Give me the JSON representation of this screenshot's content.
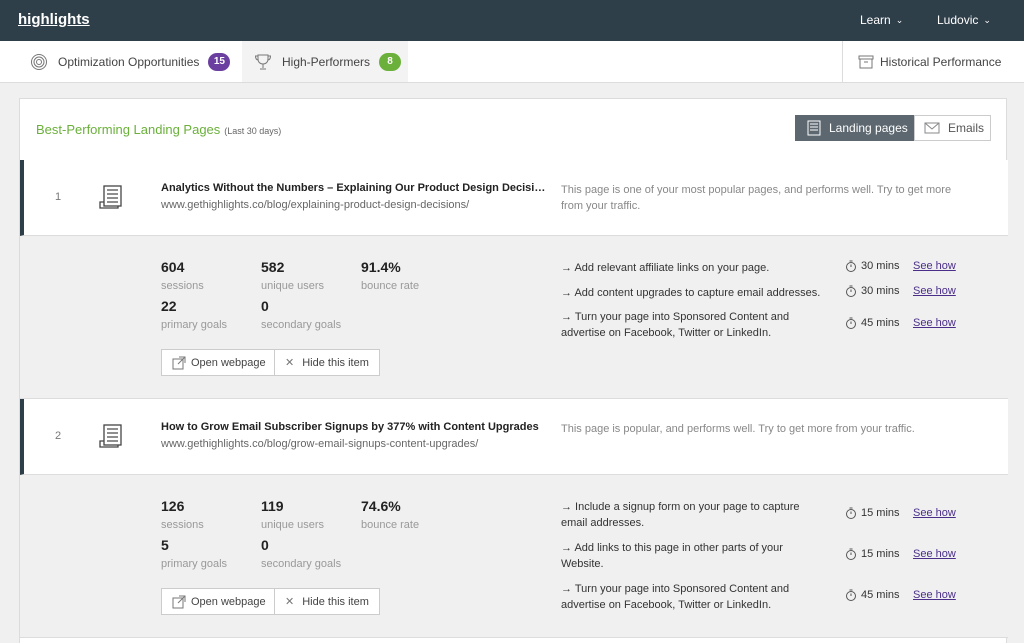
{
  "app": {
    "logo": "highlights"
  },
  "top_menu": {
    "learn": "Learn",
    "user": "Ludovic"
  },
  "tabs": [
    {
      "label": "Optimization Opportunities",
      "badge": "15",
      "badge_color": "#6b3fa0"
    },
    {
      "label": "High-Performers",
      "badge": "8",
      "badge_color": "#6ab03a"
    },
    {
      "label": "Historical Performance"
    }
  ],
  "panel": {
    "title": "Best-Performing Landing Pages",
    "subtitle": "(Last 30 days)",
    "toggle_landing": "Landing pages",
    "toggle_emails": "Emails"
  },
  "labels": {
    "sessions": "sessions",
    "unique_users": "unique users",
    "bounce_rate": "bounce rate",
    "primary_goals": "primary goals",
    "secondary_goals": "secondary goals",
    "open_webpage": "Open webpage",
    "hide_item": "Hide this item",
    "see_how": "See how"
  },
  "items": [
    {
      "num": "1",
      "title": "Analytics Without the Numbers – Explaining Our Product Design Decisions",
      "url": "www.gethighlights.co/blog/explaining-product-design-decisions/",
      "description": "This page is one of your most popular pages, and performs well. Try to get more from your traffic.",
      "sessions": "604",
      "unique_users": "582",
      "bounce_rate": "91.4%",
      "primary_goals": "22",
      "secondary_goals": "0",
      "actions": [
        {
          "text": "→ Add relevant affiliate links on your page.",
          "time": "30 mins"
        },
        {
          "text": "→ Add content upgrades to capture email addresses.",
          "time": "30 mins"
        },
        {
          "text": "→ Turn your page into Sponsored Content and advertise on Facebook, Twitter or LinkedIn.",
          "time": "45 mins"
        }
      ]
    },
    {
      "num": "2",
      "title": "How to Grow Email Subscriber Signups by 377% with Content Upgrades",
      "url": "www.gethighlights.co/blog/grow-email-signups-content-upgrades/",
      "description": "This page is popular, and performs well. Try to get more from your traffic.",
      "sessions": "126",
      "unique_users": "119",
      "bounce_rate": "74.6%",
      "primary_goals": "5",
      "secondary_goals": "0",
      "actions": [
        {
          "text": "→ Include a signup form on your page to capture email addresses.",
          "time": "15 mins"
        },
        {
          "text": "→ Add links to this page in other parts of your Website.",
          "time": "15 mins"
        },
        {
          "text": "→ Turn your page into Sponsored Content and advertise on Facebook, Twitter or LinkedIn.",
          "time": "45 mins"
        }
      ]
    }
  ]
}
